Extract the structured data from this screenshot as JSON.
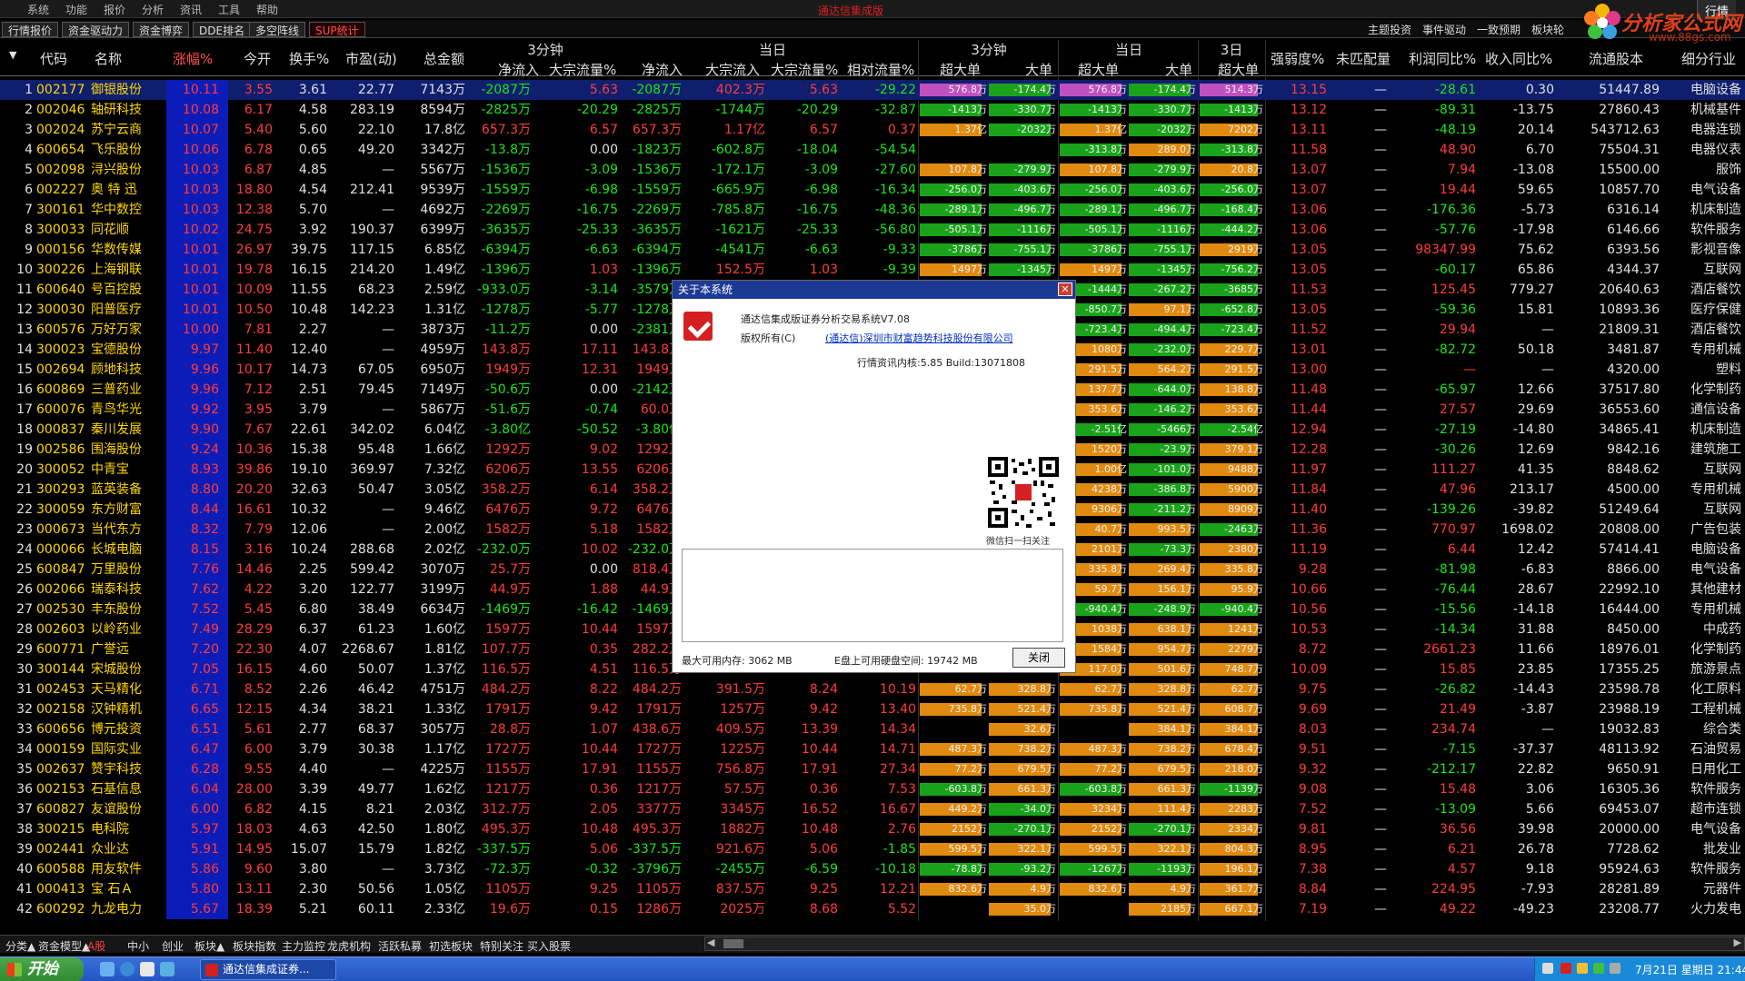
{
  "menu": {
    "items": [
      "系统",
      "功能",
      "报价",
      "分析",
      "资讯",
      "工具",
      "帮助"
    ],
    "title": "通达信集成版",
    "app_tag": "行情"
  },
  "tabs": {
    "items": [
      "行情报价",
      "资金驱动力",
      "资金博弈",
      "DDE排名",
      "多空阵线",
      "SUP统计"
    ],
    "active": 5
  },
  "right_tabs": {
    "items": [
      "主题投资",
      "事件驱动",
      "一致预期",
      "板块轮"
    ]
  },
  "logo": {
    "text": "分析家公式网",
    "url": "www.88gs.com"
  },
  "groups": [
    "3分钟",
    "当日",
    "3分钟",
    "当日",
    "3日"
  ],
  "columns": [
    "代码",
    "名称",
    "涨幅%",
    "今开",
    "换手%",
    "市盈(动)",
    "总金额",
    "净流入",
    "大宗流量%",
    "净流入",
    "大宗流入",
    "大宗流量%",
    "相对流量%",
    "超大单",
    "大单",
    "超大单",
    "大单",
    "超大单",
    "强弱度%",
    "未匹配量",
    "利润同比%",
    "收入同比%",
    "流通股本",
    "细分行业"
  ],
  "rows": [
    [
      "1",
      "002177",
      "御银股份",
      "10.11",
      "3.55",
      "3.61",
      "22.77",
      "7143万",
      "-2087万",
      "5.63",
      "-2087万",
      "402.3万",
      "5.63",
      "-29.22",
      "576.8万",
      "-174.4万",
      "576.8万",
      "-174.4万",
      "514.3万",
      "13.15",
      "—",
      "-28.61",
      "0.30",
      "51447.89",
      "电脑设备"
    ],
    [
      "2",
      "002046",
      "轴研科技",
      "10.08",
      "6.17",
      "4.58",
      "283.19",
      "8594万",
      "-2825万",
      "-20.29",
      "-2825万",
      "-1744万",
      "-20.29",
      "-32.87",
      "-1413万",
      "-330.7万",
      "-1413万",
      "-330.7万",
      "-1413万",
      "13.12",
      "—",
      "-89.31",
      "-13.75",
      "27860.43",
      "机械基件"
    ],
    [
      "3",
      "002024",
      "苏宁云商",
      "10.07",
      "5.40",
      "5.60",
      "22.10",
      "17.8亿",
      "657.3万",
      "6.57",
      "657.3万",
      "1.17亿",
      "6.57",
      "0.37",
      "1.37亿",
      "-2032万",
      "1.37亿",
      "-2032万",
      "7202万",
      "13.11",
      "—",
      "-48.19",
      "20.14",
      "543712.63",
      "电器连锁"
    ],
    [
      "4",
      "600654",
      "飞乐股份",
      "10.06",
      "6.78",
      "0.65",
      "49.20",
      "3342万",
      "-13.8万",
      "0.00",
      "-1823万",
      "-602.8万",
      "-18.04",
      "-54.54",
      "",
      "",
      "-313.8万",
      "289.0万",
      "-313.8万",
      "11.58",
      "—",
      "48.90",
      "6.70",
      "75504.31",
      "电器仪表"
    ],
    [
      "5",
      "002098",
      "浔兴股份",
      "10.03",
      "6.87",
      "4.85",
      "—",
      "5567万",
      "-1536万",
      "-3.09",
      "-1536万",
      "-172.1万",
      "-3.09",
      "-27.60",
      "107.8万",
      "-279.9万",
      "107.8万",
      "-279.9万",
      "20.8万",
      "13.07",
      "—",
      "7.94",
      "-13.08",
      "15500.00",
      "服饰"
    ],
    [
      "6",
      "002227",
      "奥 特 迅",
      "10.03",
      "18.80",
      "4.54",
      "212.41",
      "9539万",
      "-1559万",
      "-6.98",
      "-1559万",
      "-665.9万",
      "-6.98",
      "-16.34",
      "-256.0万",
      "-403.6万",
      "-256.0万",
      "-403.6万",
      "-256.0万",
      "13.07",
      "—",
      "19.44",
      "59.65",
      "10857.70",
      "电气设备"
    ],
    [
      "7",
      "300161",
      "华中数控",
      "10.03",
      "12.38",
      "5.70",
      "—",
      "4692万",
      "-2269万",
      "-16.75",
      "-2269万",
      "-785.8万",
      "-16.75",
      "-48.36",
      "-289.1万",
      "-496.7万",
      "-289.1万",
      "-496.7万",
      "-168.4万",
      "13.06",
      "—",
      "-176.36",
      "-5.73",
      "6316.14",
      "机床制造"
    ],
    [
      "8",
      "300033",
      "同花顺",
      "10.02",
      "24.75",
      "3.92",
      "190.37",
      "6399万",
      "-3635万",
      "-25.33",
      "-3635万",
      "-1621万",
      "-25.33",
      "-56.80",
      "-505.1万",
      "-1116万",
      "-505.1万",
      "-1116万",
      "-444.2万",
      "13.06",
      "—",
      "-57.76",
      "-17.98",
      "6146.66",
      "软件服务"
    ],
    [
      "9",
      "000156",
      "华数传媒",
      "10.01",
      "26.97",
      "39.75",
      "117.15",
      "6.85亿",
      "-6394万",
      "-6.63",
      "-6394万",
      "-4541万",
      "-6.63",
      "-9.33",
      "-3786万",
      "-755.1万",
      "-3786万",
      "-755.1万",
      "2919万",
      "13.05",
      "—",
      "98347.99",
      "75.62",
      "6393.56",
      "影视音像"
    ],
    [
      "10",
      "300226",
      "上海钢联",
      "10.01",
      "19.78",
      "16.15",
      "214.20",
      "1.49亿",
      "-1396万",
      "1.03",
      "-1396万",
      "152.5万",
      "1.03",
      "-9.39",
      "1497万",
      "-1345万",
      "1497万",
      "-1345万",
      "-756.2万",
      "13.05",
      "—",
      "-60.17",
      "65.86",
      "4344.37",
      "互联网"
    ],
    [
      "11",
      "600640",
      "号百控股",
      "10.01",
      "10.09",
      "11.55",
      "68.23",
      "2.59亿",
      "-933.0万",
      "-3.14",
      "-3579万",
      "",
      "",
      "",
      "",
      "",
      "-1444万",
      "-267.2万",
      "-3685万",
      "11.53",
      "—",
      "125.45",
      "779.27",
      "20640.63",
      "酒店餐饮"
    ],
    [
      "12",
      "300030",
      "阳普医疗",
      "10.01",
      "10.50",
      "10.48",
      "142.23",
      "1.31亿",
      "-1278万",
      "-5.77",
      "-1278万",
      "",
      "",
      "",
      "",
      "",
      "-850.7万",
      "97.1万",
      "-652.8万",
      "13.05",
      "—",
      "-59.36",
      "15.81",
      "10893.36",
      "医疗保健"
    ],
    [
      "13",
      "600576",
      "万好万家",
      "10.00",
      "7.81",
      "2.27",
      "—",
      "3873万",
      "-11.2万",
      "0.00",
      "-2381万",
      "",
      "",
      "",
      "",
      "",
      "-723.4万",
      "-494.4万",
      "-723.4万",
      "11.52",
      "—",
      "29.94",
      "—",
      "21809.31",
      "酒店餐饮"
    ],
    [
      "14",
      "300023",
      "宝德股份",
      "9.97",
      "11.40",
      "12.40",
      "—",
      "4959万",
      "143.8万",
      "17.11",
      "143.8万",
      "",
      "",
      "",
      "",
      "",
      "1080万",
      "-232.0万",
      "229.7万",
      "13.01",
      "—",
      "-82.72",
      "50.18",
      "3481.87",
      "专用机械"
    ],
    [
      "15",
      "002694",
      "顾地科技",
      "9.96",
      "10.17",
      "14.73",
      "67.05",
      "6950万",
      "1949万",
      "12.31",
      "1949万",
      "",
      "",
      "",
      "",
      "",
      "291.5万",
      "564.2万",
      "291.5万",
      "13.00",
      "—",
      "—",
      "—",
      "4320.00",
      "塑料"
    ],
    [
      "16",
      "600869",
      "三普药业",
      "9.96",
      "7.12",
      "2.51",
      "79.45",
      "7149万",
      "-50.6万",
      "0.00",
      "-2142万",
      "",
      "",
      "",
      "",
      "",
      "137.7万",
      "-644.0万",
      "138.8万",
      "11.48",
      "—",
      "-65.97",
      "12.66",
      "37517.80",
      "化学制药"
    ],
    [
      "17",
      "600076",
      "青鸟华光",
      "9.92",
      "3.95",
      "3.79",
      "—",
      "5867万",
      "-51.6万",
      "-0.74",
      "60.0万",
      "",
      "",
      "",
      "",
      "",
      "353.6万",
      "-146.2万",
      "353.6万",
      "11.44",
      "—",
      "27.57",
      "29.69",
      "36553.60",
      "通信设备"
    ],
    [
      "18",
      "000837",
      "秦川发展",
      "9.90",
      "7.67",
      "22.61",
      "342.02",
      "6.04亿",
      "-3.80亿",
      "-50.52",
      "-3.80亿",
      "",
      "",
      "",
      "",
      "",
      "-2.51亿",
      "-5466万",
      "-2.54亿",
      "12.94",
      "—",
      "-27.19",
      "-14.80",
      "34865.41",
      "机床制造"
    ],
    [
      "19",
      "002586",
      "围海股份",
      "9.24",
      "10.36",
      "15.38",
      "95.48",
      "1.66亿",
      "1292万",
      "9.02",
      "1292万",
      "",
      "",
      "",
      "",
      "",
      "1520万",
      "-23.9万",
      "379.1万",
      "12.28",
      "—",
      "-30.26",
      "12.69",
      "9842.16",
      "建筑施工"
    ],
    [
      "20",
      "300052",
      "中青宝",
      "8.93",
      "39.86",
      "19.10",
      "369.97",
      "7.32亿",
      "6206万",
      "13.55",
      "6206万",
      "",
      "",
      "",
      "",
      "",
      "1.00亿",
      "-101.0万",
      "9488万",
      "11.97",
      "—",
      "111.27",
      "41.35",
      "8848.62",
      "互联网"
    ],
    [
      "21",
      "300293",
      "蓝英装备",
      "8.80",
      "20.20",
      "32.63",
      "50.47",
      "3.05亿",
      "358.2万",
      "6.14",
      "358.2万",
      "",
      "",
      "",
      "",
      "",
      "4238万",
      "-386.8万",
      "5900万",
      "11.84",
      "—",
      "47.96",
      "213.17",
      "4500.00",
      "专用机械"
    ],
    [
      "22",
      "300059",
      "东方财富",
      "8.44",
      "16.61",
      "10.32",
      "—",
      "9.46亿",
      "6476万",
      "9.72",
      "6476万",
      "",
      "",
      "",
      "",
      "",
      "9306万",
      "-211.2万",
      "8909万",
      "11.40",
      "—",
      "-139.26",
      "-39.82",
      "51249.64",
      "互联网"
    ],
    [
      "23",
      "000673",
      "当代东方",
      "8.32",
      "7.79",
      "12.06",
      "—",
      "2.00亿",
      "1582万",
      "5.18",
      "1582万",
      "",
      "",
      "",
      "",
      "",
      "40.7万",
      "993.5万",
      "-2463万",
      "11.36",
      "—",
      "770.97",
      "1698.02",
      "20808.00",
      "广告包装"
    ],
    [
      "24",
      "000066",
      "长城电脑",
      "8.15",
      "3.16",
      "10.24",
      "288.68",
      "2.02亿",
      "-232.0万",
      "10.02",
      "-232.0万",
      "",
      "",
      "",
      "",
      "",
      "2101万",
      "-73.3万",
      "2380万",
      "11.19",
      "—",
      "6.44",
      "12.42",
      "57414.41",
      "电脑设备"
    ],
    [
      "25",
      "600847",
      "万里股份",
      "7.76",
      "14.46",
      "2.25",
      "599.42",
      "3070万",
      "25.7万",
      "0.00",
      "818.4万",
      "",
      "",
      "",
      "",
      "",
      "335.8万",
      "269.4万",
      "335.8万",
      "9.28",
      "—",
      "-81.98",
      "-6.83",
      "8866.00",
      "电气设备"
    ],
    [
      "26",
      "002066",
      "瑞泰科技",
      "7.62",
      "4.22",
      "3.20",
      "122.77",
      "3199万",
      "44.9万",
      "1.88",
      "44.9万",
      "",
      "",
      "",
      "",
      "",
      "59.7万",
      "156.1万",
      "95.9万",
      "10.66",
      "—",
      "-76.44",
      "28.67",
      "22992.10",
      "其他建材"
    ],
    [
      "27",
      "002530",
      "丰东股份",
      "7.52",
      "5.45",
      "6.80",
      "38.49",
      "6634万",
      "-1469万",
      "-16.42",
      "-1469万",
      "",
      "",
      "",
      "",
      "",
      "-940.4万",
      "-248.9万",
      "-940.4万",
      "10.56",
      "—",
      "-15.56",
      "-14.18",
      "16444.00",
      "专用机械"
    ],
    [
      "28",
      "002603",
      "以岭药业",
      "7.49",
      "28.29",
      "6.37",
      "61.23",
      "1.60亿",
      "1597万",
      "10.44",
      "1597万",
      "",
      "",
      "",
      "",
      "",
      "1038万",
      "638.1万",
      "1241万",
      "10.53",
      "—",
      "-14.34",
      "31.88",
      "8450.00",
      "中成药"
    ],
    [
      "29",
      "600771",
      "广誉远",
      "7.20",
      "22.30",
      "4.07",
      "2268.67",
      "1.81亿",
      "107.7万",
      "0.35",
      "282.2万",
      "",
      "",
      "",
      "",
      "",
      "1584万",
      "954.7万",
      "2279万",
      "8.72",
      "—",
      "2661.23",
      "11.66",
      "18976.01",
      "化学制药"
    ],
    [
      "30",
      "300144",
      "宋城股份",
      "7.05",
      "16.15",
      "4.60",
      "50.07",
      "1.37亿",
      "116.5万",
      "4.51",
      "116.5万",
      "",
      "",
      "",
      "",
      "",
      "117.0万",
      "501.6万",
      "748.7万",
      "10.09",
      "—",
      "15.85",
      "23.85",
      "17355.25",
      "旅游景点"
    ],
    [
      "31",
      "002453",
      "天马精化",
      "6.71",
      "8.52",
      "2.26",
      "46.42",
      "4751万",
      "484.2万",
      "8.22",
      "484.2万",
      "391.5万",
      "8.24",
      "10.19",
      "62.7万",
      "328.8万",
      "62.7万",
      "328.8万",
      "62.7万",
      "9.75",
      "—",
      "-26.82",
      "-14.43",
      "23598.78",
      "化工原料"
    ],
    [
      "32",
      "002158",
      "汉钟精机",
      "6.65",
      "12.15",
      "4.34",
      "38.21",
      "1.33亿",
      "1791万",
      "9.42",
      "1791万",
      "1257万",
      "9.42",
      "13.40",
      "735.8万",
      "521.4万",
      "735.8万",
      "521.4万",
      "608.7万",
      "9.69",
      "—",
      "21.49",
      "-3.87",
      "23988.19",
      "工程机械"
    ],
    [
      "33",
      "600656",
      "博元投资",
      "6.51",
      "5.61",
      "2.77",
      "68.37",
      "3057万",
      "28.8万",
      "1.07",
      "438.6万",
      "409.5万",
      "13.39",
      "14.34",
      "",
      "32.6万",
      "",
      "384.1万",
      "384.1万",
      "8.03",
      "—",
      "234.74",
      "—",
      "19032.83",
      "综合类"
    ],
    [
      "34",
      "000159",
      "国际实业",
      "6.47",
      "6.00",
      "3.79",
      "30.38",
      "1.17亿",
      "1727万",
      "10.44",
      "1727万",
      "1225万",
      "10.44",
      "14.71",
      "487.3万",
      "738.2万",
      "487.3万",
      "738.2万",
      "678.4万",
      "9.51",
      "—",
      "-7.15",
      "-37.37",
      "48113.92",
      "石油贸易"
    ],
    [
      "35",
      "002637",
      "赞宇科技",
      "6.28",
      "9.55",
      "4.40",
      "—",
      "4225万",
      "1155万",
      "17.91",
      "1155万",
      "756.8万",
      "17.91",
      "27.34",
      "77.2万",
      "679.5万",
      "77.2万",
      "679.5万",
      "218.0万",
      "9.32",
      "—",
      "-212.17",
      "22.82",
      "9650.91",
      "日用化工"
    ],
    [
      "36",
      "002153",
      "石基信息",
      "6.04",
      "28.00",
      "3.39",
      "49.77",
      "1.62亿",
      "1217万",
      "0.36",
      "1217万",
      "57.5万",
      "0.36",
      "7.53",
      "-603.8万",
      "661.3万",
      "-603.8万",
      "661.3万",
      "-1139万",
      "9.08",
      "—",
      "15.48",
      "3.06",
      "16305.36",
      "软件服务"
    ],
    [
      "37",
      "600827",
      "友谊股份",
      "6.00",
      "6.82",
      "4.15",
      "8.21",
      "2.03亿",
      "312.7万",
      "2.05",
      "3377万",
      "3345万",
      "16.52",
      "16.67",
      "449.2万",
      "-34.0万",
      "3234万",
      "111.4万",
      "2283万",
      "7.52",
      "—",
      "-13.09",
      "5.66",
      "69453.07",
      "超市连锁"
    ],
    [
      "38",
      "300215",
      "电科院",
      "5.97",
      "18.03",
      "4.63",
      "42.50",
      "1.80亿",
      "495.3万",
      "10.48",
      "495.3万",
      "1882万",
      "10.48",
      "2.76",
      "2152万",
      "-270.1万",
      "2152万",
      "-270.1万",
      "2334万",
      "9.81",
      "—",
      "36.56",
      "39.98",
      "20000.00",
      "电气设备"
    ],
    [
      "39",
      "002441",
      "众业达",
      "5.91",
      "14.95",
      "15.07",
      "15.79",
      "1.82亿",
      "-337.5万",
      "5.06",
      "-337.5万",
      "921.6万",
      "5.06",
      "-1.85",
      "599.5万",
      "322.1万",
      "599.5万",
      "322.1万",
      "804.3万",
      "8.95",
      "—",
      "6.21",
      "26.78",
      "7728.62",
      "批发业"
    ],
    [
      "40",
      "600588",
      "用友软件",
      "5.86",
      "9.60",
      "3.80",
      "—",
      "3.73亿",
      "-72.3万",
      "-0.32",
      "-3796万",
      "-2455万",
      "-6.59",
      "-10.18",
      "-78.8万",
      "-93.2万",
      "-1267万",
      "-1193万",
      "196.1万",
      "7.38",
      "—",
      "4.57",
      "9.18",
      "95924.63",
      "软件服务"
    ],
    [
      "41",
      "000413",
      "宝 石Ａ",
      "5.80",
      "13.11",
      "2.30",
      "50.56",
      "1.05亿",
      "1105万",
      "9.25",
      "1105万",
      "837.5万",
      "9.25",
      "12.21",
      "832.6万",
      "4.9万",
      "832.6万",
      "4.9万",
      "361.7万",
      "8.84",
      "—",
      "224.95",
      "-7.93",
      "28281.89",
      "元器件"
    ],
    [
      "42",
      "600292",
      "九龙电力",
      "5.67",
      "18.39",
      "5.21",
      "60.11",
      "2.33亿",
      "19.6万",
      "0.15",
      "1286万",
      "2025万",
      "8.68",
      "5.52",
      "",
      "35.0万",
      "",
      "2185万",
      "667.1万",
      "7.19",
      "—",
      "49.22",
      "-49.23",
      "23208.77",
      "火力发电"
    ]
  ],
  "dialog": {
    "title": "关于本系统",
    "product": "通达信集成版证券分析交易系统V7.08",
    "copyright_label": "版权所有(C)",
    "company": "(通达信)深圳市财富趋势科技股份有限公司",
    "kernel": "行情资讯内核:5.85 Build:13071808",
    "qr_caption": "微信扫一扫关注",
    "memory": "最大可用内存: 3062 MB",
    "disk": "E盘上可用硬盘空间: 19742 MB",
    "close_label": "关闭"
  },
  "bottom_tabs": {
    "items": [
      "分类▲",
      "资金模型▲",
      "A股",
      "中小",
      "创业",
      "板块▲",
      "板块指数",
      "主力监控",
      "龙虎机构",
      "活跃私募",
      "初选板块",
      "特别关注",
      "买入股票"
    ],
    "active": 2
  },
  "taskbar": {
    "start": "开始",
    "task": "通达信集成证券...",
    "clock": "7月21日 星期日 21:44:01"
  },
  "colors": {
    "up": "#ff3c3c",
    "down": "#19e619",
    "selected_row": "#0f1f6e",
    "pct_column": "#0c1cb8"
  }
}
